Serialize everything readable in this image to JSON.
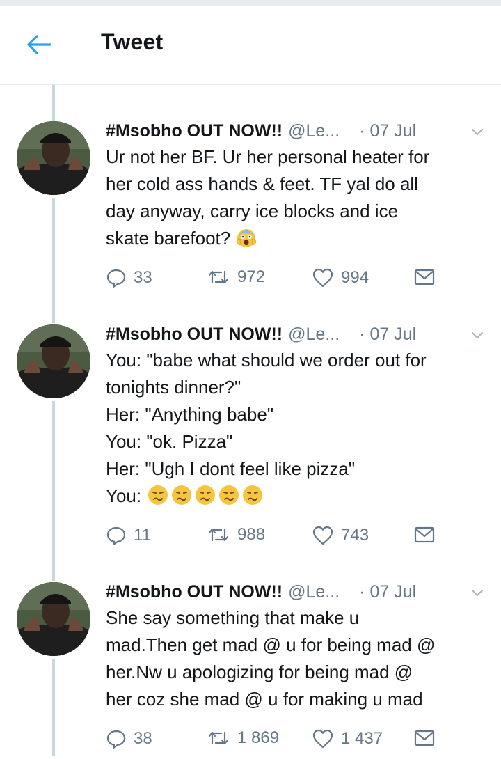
{
  "header": {
    "title": "Tweet"
  },
  "tweets": [
    {
      "name": "#Msobho OUT NOW!!",
      "handle": "@Le...",
      "date": "· 07 Jul",
      "lines": [
        "Ur not her BF. Ur her personal heater for",
        "her cold ass hands & feet. TF yal do all",
        "day anyway, carry ice blocks and ice",
        "skate barefoot?"
      ],
      "replies": "33",
      "retweets": "972",
      "likes": "994"
    },
    {
      "name": "#Msobho OUT NOW!!",
      "handle": "@Le...",
      "date": "· 07 Jul",
      "lines": [
        "You: \"babe what should we order out for",
        "tonights dinner?\"",
        "Her: \"Anything babe\"",
        "You: \"ok. Pizza\"",
        "Her: \"Ugh I dont feel like pizza\"",
        "You:"
      ],
      "replies": "11",
      "retweets": "988",
      "likes": "743"
    },
    {
      "name": "#Msobho OUT NOW!!",
      "handle": "@Le...",
      "date": "· 07 Jul",
      "lines": [
        "She say something that make u",
        "mad.Then get mad @ u for being mad @",
        "her.Nw u apologizing for being mad @",
        "her coz she mad @ u for making u mad"
      ],
      "replies": "38",
      "retweets": "1 869",
      "likes": "1 437"
    }
  ],
  "icons": {
    "back": "arrow-left-icon",
    "reply": "reply-icon",
    "retweet": "retweet-icon",
    "like": "heart-icon",
    "share": "share-icon",
    "caret": "chevron-down-icon"
  },
  "colors": {
    "accent": "#1da1f2",
    "text": "#14171a",
    "secondary": "#657786",
    "divider": "#ccd6dd"
  }
}
